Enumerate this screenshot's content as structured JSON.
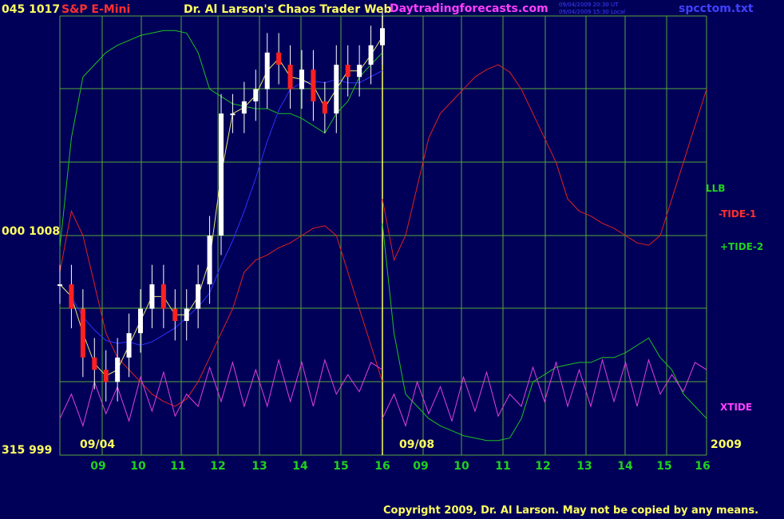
{
  "header": {
    "price_scale_top": "045  1017",
    "symbol": "S&P E-Mini",
    "title": "Dr. Al Larson's Chaos Trader Web",
    "site": "Daytradingforecasts.com",
    "stamp_ut": "09/04/2009 20:30 UT",
    "stamp_local": "09/04/2009 15:30 Local",
    "filename": "spcctom.txt"
  },
  "left_scale": {
    "mid": "000  1008",
    "bottom": "315   999"
  },
  "date_labels": {
    "left": "09/04",
    "right": "09/08",
    "year": "2009"
  },
  "series_labels": {
    "llb": "LLB",
    "tide1": "-TIDE-1",
    "tide2": "+TIDE-2",
    "xtide": "XTIDE"
  },
  "footer": {
    "copyright": "Copyright 2009, Dr. Al Larson. May not be copied by any means."
  },
  "colors": {
    "background": "#000058",
    "grid": "#58a838",
    "price": "#ffffff",
    "tide1": "#e02020",
    "tide2": "#20c020",
    "xtide": "#e040e0",
    "llb": "#20c020",
    "ma_blue": "#3030ff",
    "ma_yellow": "#e8e870",
    "cursor": "#ffff60"
  },
  "chart_data": {
    "type": "line",
    "ylim": [
      999,
      1017
    ],
    "y_ticks": [
      999,
      1008,
      1017
    ],
    "x_tick_labels": [
      "09",
      "10",
      "11",
      "12",
      "13",
      "14",
      "15",
      "16",
      "09",
      "10",
      "11",
      "12",
      "13",
      "14",
      "15",
      "16"
    ],
    "x": [
      9.0,
      9.25,
      9.5,
      9.75,
      10.0,
      10.25,
      10.5,
      10.75,
      11.0,
      11.25,
      11.5,
      11.75,
      12.0,
      12.25,
      12.5,
      12.75,
      13.0,
      13.25,
      13.5,
      13.75,
      14.0,
      14.25,
      14.5,
      14.75,
      15.0,
      15.25,
      15.5,
      15.75,
      16.0
    ],
    "series": [
      {
        "name": "price",
        "values": [
          1006,
          1005,
          1003,
          1002.5,
          1002,
          1003,
          1004,
          1005,
          1006,
          1005,
          1004.5,
          1005,
          1006,
          1008,
          1013,
          1013,
          1013.5,
          1014,
          1015.5,
          1015,
          1014,
          1014.8,
          1013.5,
          1013,
          1015,
          1014.5,
          1015,
          1015.8,
          1016.5
        ]
      },
      {
        "name": "+TIDE-2",
        "values": [
          1007.5,
          1012,
          1014.5,
          1015,
          1015.5,
          1015.8,
          1016,
          1016.2,
          1016.3,
          1016.4,
          1016.4,
          1016.3,
          1015.5,
          1014,
          1013.7,
          1013.4,
          1013.3,
          1013.2,
          1013.2,
          1013.0,
          1013.0,
          1012.8,
          1012.5,
          1012.2,
          1013,
          1013.5,
          1014.5,
          1015,
          1015.5
        ]
      },
      {
        "name": "-TIDE-1",
        "values": [
          1006.5,
          1009,
          1008,
          1006,
          1004,
          1003,
          1002.5,
          1002,
          1001.5,
          1001.2,
          1001,
          1001.3,
          1002,
          1003,
          1004,
          1005,
          1006.5,
          1007,
          1007.2,
          1007.5,
          1007.7,
          1008,
          1008.3,
          1008.4,
          1008,
          1006.5,
          1005,
          1003.5,
          1002
        ]
      },
      {
        "name": "XTIDE",
        "values": [
          1000.5,
          1001.5,
          1000.2,
          1002,
          1000.7,
          1001.8,
          1000.4,
          1002.2,
          1000.8,
          1002.4,
          1000.6,
          1001.5,
          1001,
          1002.6,
          1001.2,
          1002.8,
          1001,
          1002.5,
          1001,
          1002.9,
          1001.2,
          1002.8,
          1001,
          1002.9,
          1001.5,
          1002.3,
          1001.6,
          1002.8,
          1002.5
        ]
      }
    ]
  }
}
